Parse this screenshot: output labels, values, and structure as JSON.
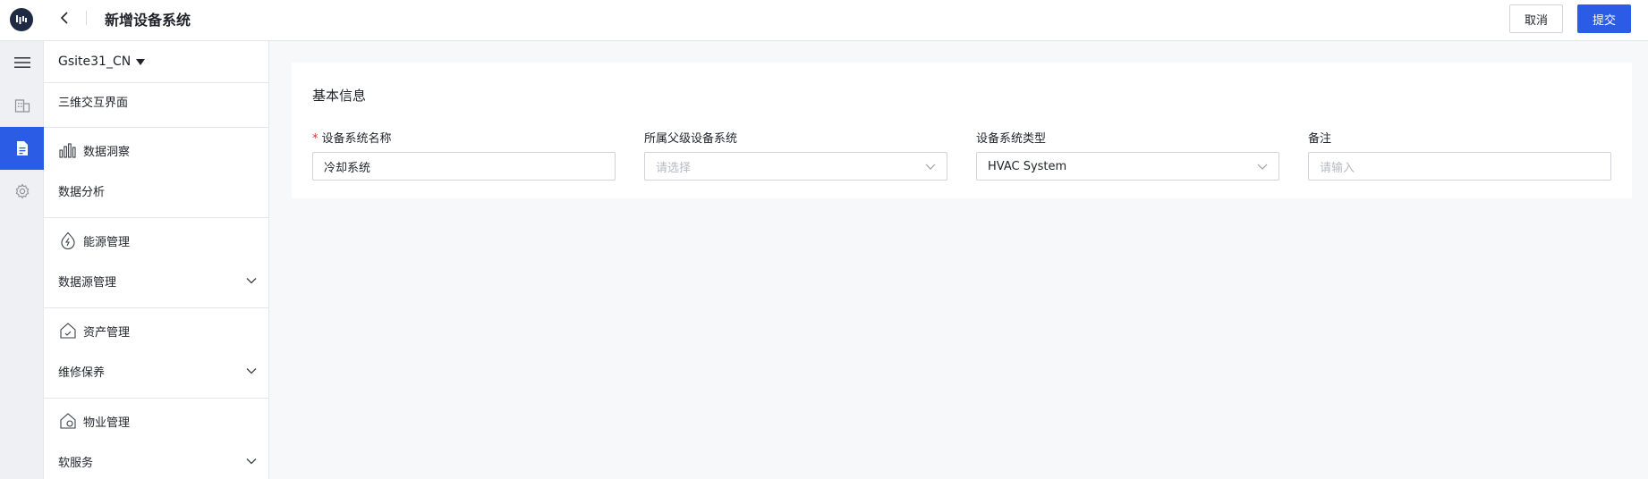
{
  "header": {
    "title": "新增设备系统",
    "cancel_label": "取消",
    "submit_label": "提交"
  },
  "rail": {
    "items": [
      {
        "icon": "menu-icon",
        "active": false
      },
      {
        "icon": "building-icon",
        "active": false
      },
      {
        "icon": "document-icon",
        "active": true
      },
      {
        "icon": "gear-icon",
        "active": false
      }
    ]
  },
  "menu": {
    "site": "Gsite31_CN",
    "item_3d": "三维交互界面",
    "group_insight": "数据洞察",
    "item_analysis": "数据分析",
    "group_energy": "能源管理",
    "item_datasource": "数据源管理",
    "group_asset": "资产管理",
    "item_maintenance": "维修保养",
    "group_property": "物业管理",
    "item_soft_service": "软服务"
  },
  "form": {
    "section_title": "基本信息",
    "fields": [
      {
        "label": "设备系统名称",
        "required": true,
        "value": "冷却系统",
        "placeholder": ""
      },
      {
        "label": "所属父级设备系统",
        "required": false,
        "value": "",
        "placeholder": "请选择"
      },
      {
        "label": "设备系统类型",
        "required": false,
        "value": "HVAC System",
        "placeholder": ""
      },
      {
        "label": "备注",
        "required": false,
        "value": "",
        "placeholder": "请输入"
      }
    ]
  },
  "colors": {
    "accent": "#2b5ce6",
    "required": "#e03131",
    "logo_bg": "#1f2a44"
  }
}
